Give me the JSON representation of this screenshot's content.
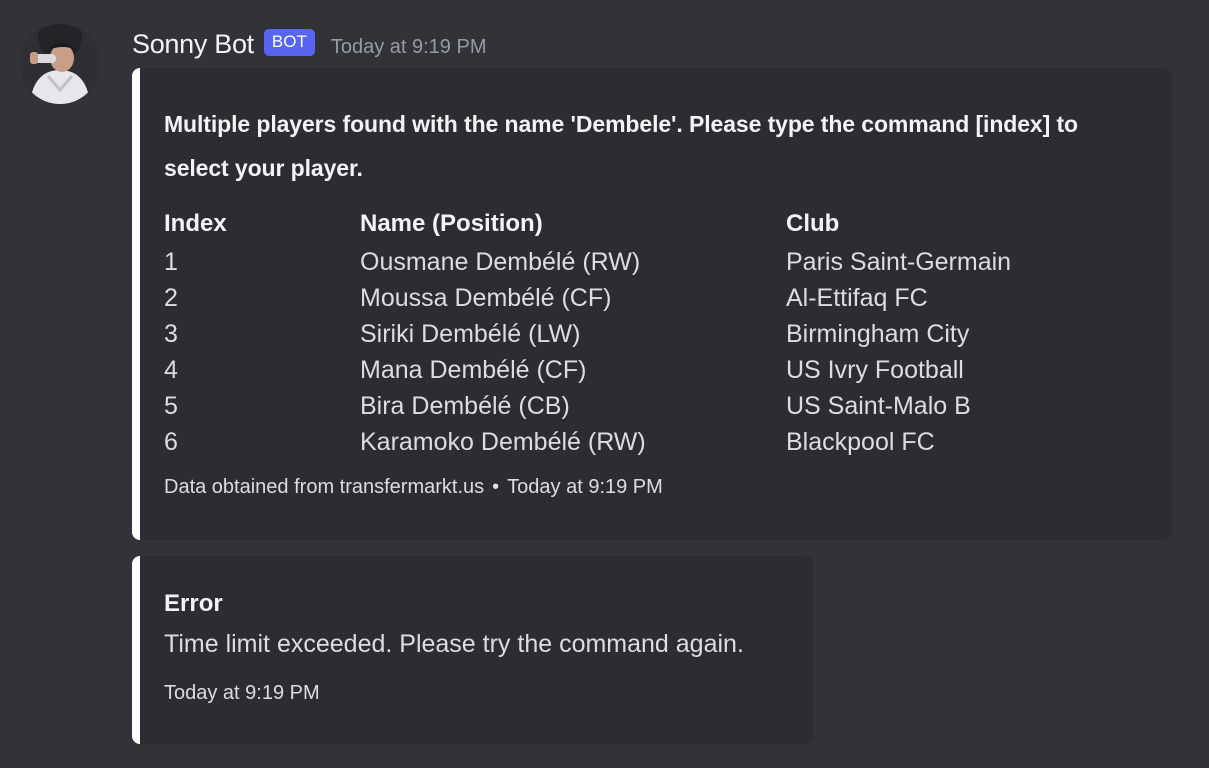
{
  "author": {
    "name": "Sonny Bot",
    "tag": "BOT",
    "timestamp": "Today at 9:19 PM",
    "avatar_icon": "user-avatar-photo"
  },
  "embeds": [
    {
      "description": "Multiple players found with the name 'Dembele'. Please type the command [index] to select your player.",
      "table": {
        "headers": [
          "Index",
          "Name (Position)",
          "Club"
        ],
        "rows": [
          {
            "index": "1",
            "name": "Ousmane Dembélé (RW)",
            "club": "Paris Saint-Germain"
          },
          {
            "index": "2",
            "name": "Moussa Dembélé (CF)",
            "club": "Al-Ettifaq FC"
          },
          {
            "index": "3",
            "name": "Siriki Dembélé (LW)",
            "club": "Birmingham City"
          },
          {
            "index": "4",
            "name": "Mana Dembélé (CF)",
            "club": "US Ivry Football"
          },
          {
            "index": "5",
            "name": "Bira Dembélé (CB)",
            "club": "US Saint-Malo B"
          },
          {
            "index": "6",
            "name": "Karamoko Dembélé (RW)",
            "club": "Blackpool FC"
          }
        ]
      },
      "footer_text": "Data obtained from transfermarkt.us",
      "footer_separator": "•",
      "footer_timestamp": "Today at 9:19 PM",
      "accent_color": "#ffffff"
    },
    {
      "title": "Error",
      "description": "Time limit exceeded. Please try the command again.",
      "footer_timestamp": "Today at 9:19 PM",
      "accent_color": "#ffffff"
    }
  ],
  "colors": {
    "background": "#313338",
    "embed_background": "#2b2d31",
    "bot_tag": "#5865f2",
    "timestamp": "#949ba4"
  }
}
